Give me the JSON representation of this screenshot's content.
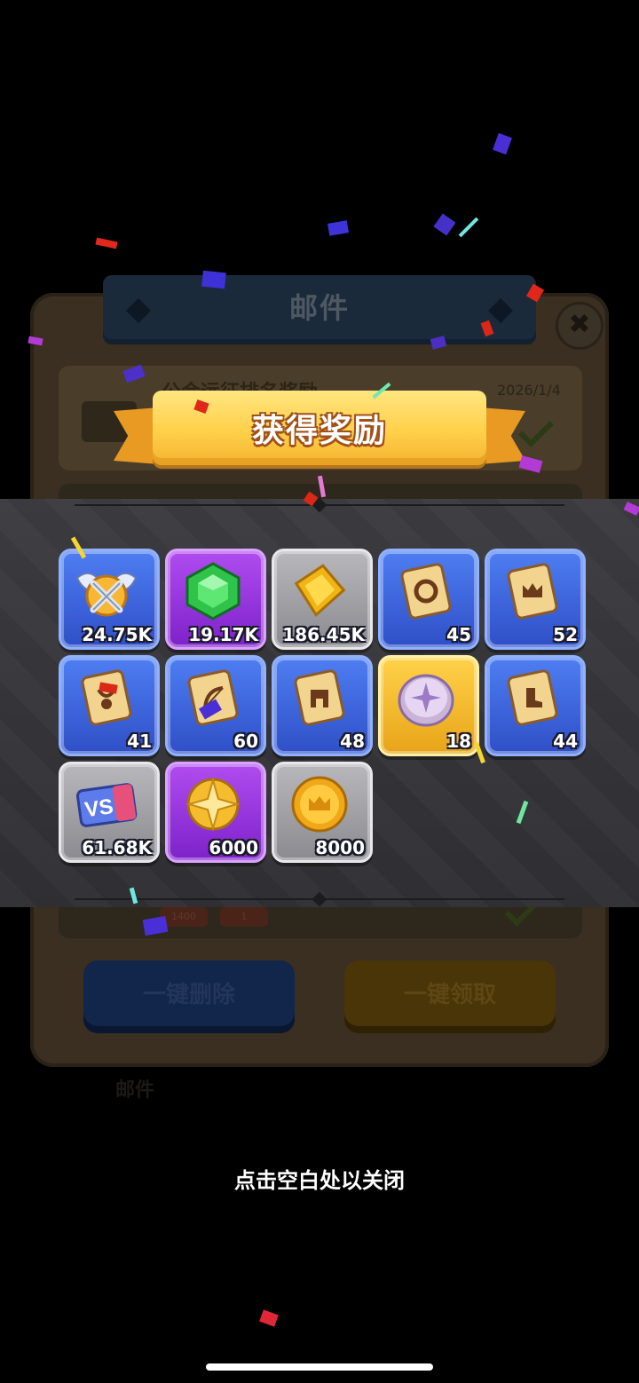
{
  "mail_window": {
    "title": "邮件",
    "close_label": "✖",
    "item_title": "公会远征排名奖励",
    "item_date": "2026/1/4",
    "chip_a": "1400",
    "chip_b": "1",
    "delete_all_label": "一键删除",
    "claim_all_label": "一键领取",
    "bottom_label": "邮件"
  },
  "reward_popup": {
    "title": "获得奖励",
    "close_hint": "点击空白处以关闭",
    "rewards": [
      {
        "icon": "winged-swords-badge-icon",
        "quantity": "24.75K",
        "rarity": "blue"
      },
      {
        "icon": "green-gem-icon",
        "quantity": "19.17K",
        "rarity": "purple"
      },
      {
        "icon": "gold-coin-icon",
        "quantity": "186.45K",
        "rarity": "gray"
      },
      {
        "icon": "scroll-helmet-icon",
        "quantity": "45",
        "rarity": "blue"
      },
      {
        "icon": "scroll-crown-icon",
        "quantity": "52",
        "rarity": "blue"
      },
      {
        "icon": "scroll-amulet-icon",
        "quantity": "41",
        "rarity": "blue"
      },
      {
        "icon": "scroll-bow-icon",
        "quantity": "60",
        "rarity": "blue"
      },
      {
        "icon": "scroll-armor-icon",
        "quantity": "48",
        "rarity": "blue"
      },
      {
        "icon": "star-coin-icon",
        "quantity": "18",
        "rarity": "gold"
      },
      {
        "icon": "scroll-boots-icon",
        "quantity": "44",
        "rarity": "blue"
      },
      {
        "icon": "vs-ticket-icon",
        "quantity": "61.68K",
        "rarity": "gray"
      },
      {
        "icon": "gold-star-emblem-icon",
        "quantity": "6000",
        "rarity": "purple"
      },
      {
        "icon": "crown-coin-icon",
        "quantity": "8000",
        "rarity": "gray"
      }
    ]
  },
  "colors": {
    "blue_tile": "#3a63dc",
    "purple_tile": "#9a36e0",
    "gray_tile": "#a0a0a6",
    "gold_tile": "#f5bd2e",
    "ribbon": "#ffd04a"
  }
}
